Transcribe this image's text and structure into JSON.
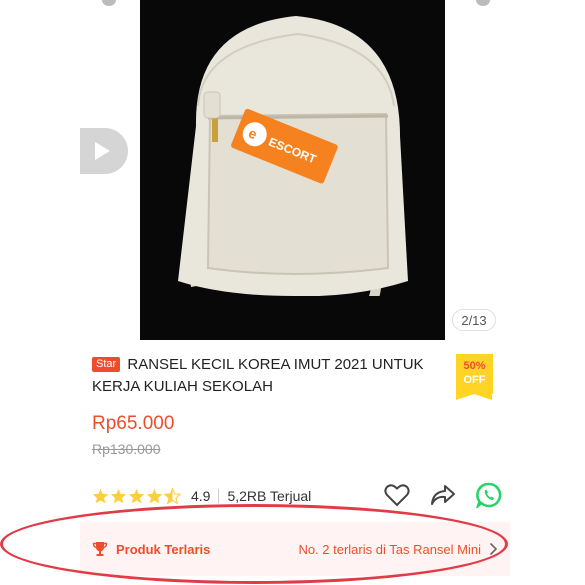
{
  "media": {
    "counter": "2/13",
    "video_icon": "play-icon",
    "tag_brand": "ESCORT"
  },
  "product": {
    "badge": "Star",
    "title": "RANSEL KECIL KOREA IMUT 2021 UNTUK KERJA KULIAH SEKOLAH",
    "discount_pct": "50%",
    "discount_word": "OFF",
    "price": "Rp65.000",
    "old_price": "Rp130.000"
  },
  "rating": {
    "value": "4.9",
    "stars": 4.5,
    "sold": "5,2RB Terjual"
  },
  "actions": {
    "icons": [
      "heart-icon",
      "share-icon",
      "whatsapp-icon"
    ]
  },
  "rank": {
    "label": "Produk Terlaris",
    "detail": "No. 2 terlaris di Tas Ransel Mini"
  },
  "colors": {
    "accent": "#ee4d2d",
    "discount_bg": "#ffd424",
    "star": "#ffce3d",
    "whatsapp": "#25d366",
    "highlight": "#e23b48"
  }
}
